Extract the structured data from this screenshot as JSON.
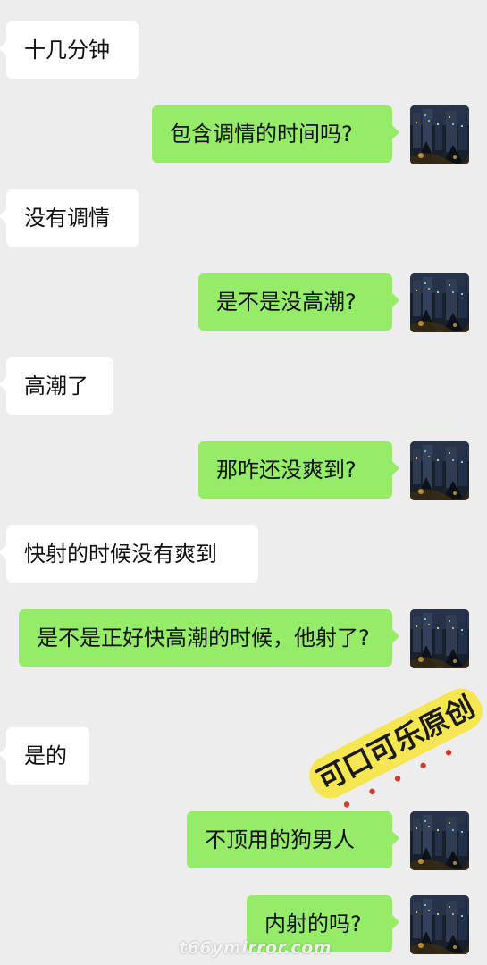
{
  "messages": [
    {
      "side": "in",
      "text": "十几分钟"
    },
    {
      "side": "out",
      "text": "包含调情的时间吗?"
    },
    {
      "side": "in",
      "text": "没有调情"
    },
    {
      "side": "out",
      "text": "是不是没高潮?"
    },
    {
      "side": "in",
      "text": "高潮了"
    },
    {
      "side": "out",
      "text": "那咋还没爽到?"
    },
    {
      "side": "in",
      "text": "快射的时候没有爽到"
    },
    {
      "side": "out",
      "text": "是不是正好快高潮的时候，他射了?"
    },
    {
      "side": "in",
      "text": "是的"
    },
    {
      "side": "out",
      "text": "不顶用的狗男人"
    },
    {
      "side": "out",
      "text": "内射的吗?"
    }
  ],
  "watermarks": {
    "stamp_text": "可口可乐原创",
    "site_text": "t66ymirror.com"
  },
  "colors": {
    "background": "#ededed",
    "incoming_bubble": "#ffffff",
    "outgoing_bubble": "#95ec69",
    "stamp_fill": "#f7e64a"
  }
}
